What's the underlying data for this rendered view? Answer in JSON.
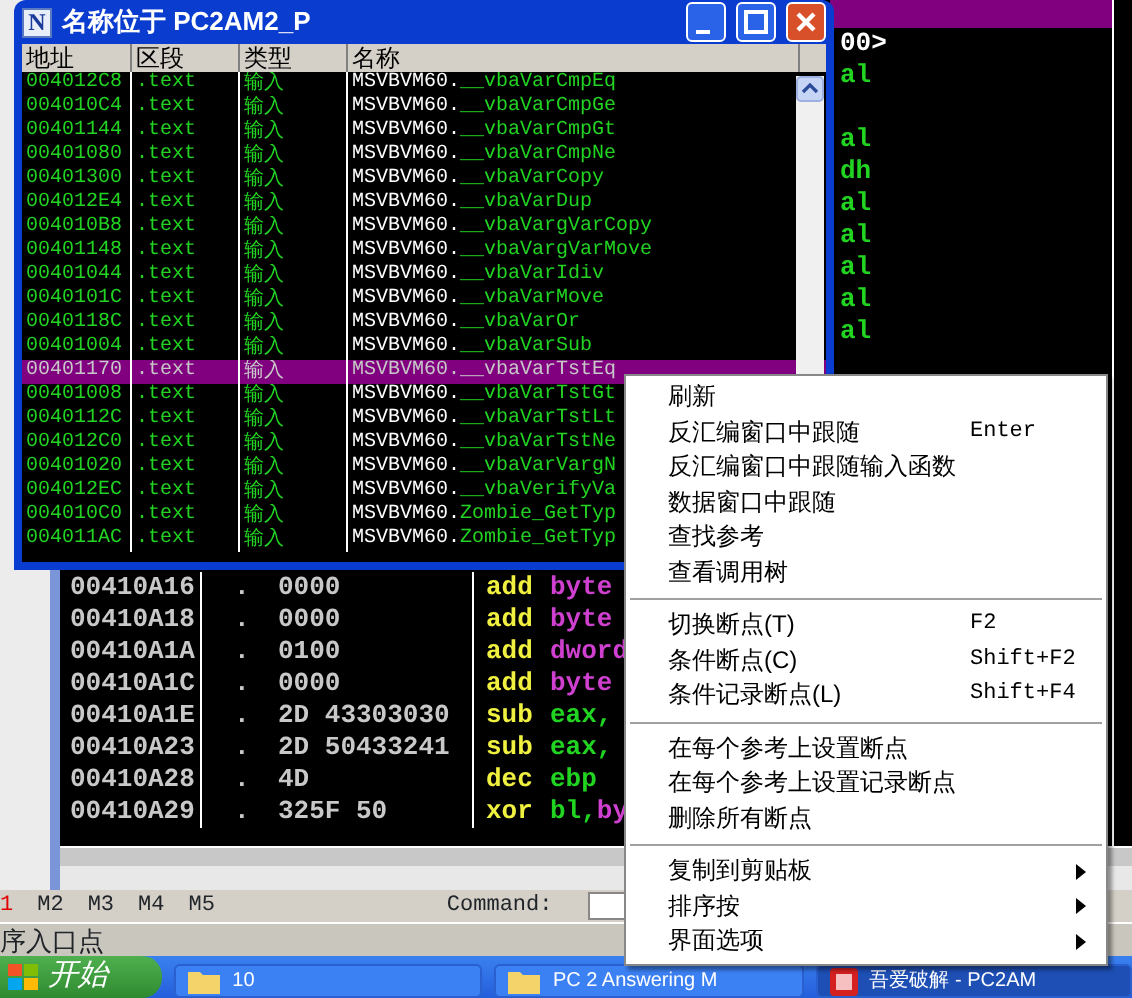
{
  "names_window": {
    "icon_letter": "N",
    "title": "名称位于 PC2AM2_P",
    "columns": [
      "地址",
      "区段",
      "类型",
      "名称"
    ],
    "rows": [
      {
        "address": "004012C8",
        "section": ".text",
        "type": "输入",
        "module": "MSVBVM60.",
        "function": "__vbaVarCmpEq",
        "selected": false
      },
      {
        "address": "004010C4",
        "section": ".text",
        "type": "输入",
        "module": "MSVBVM60.",
        "function": "__vbaVarCmpGe",
        "selected": false
      },
      {
        "address": "00401144",
        "section": ".text",
        "type": "输入",
        "module": "MSVBVM60.",
        "function": "__vbaVarCmpGt",
        "selected": false
      },
      {
        "address": "00401080",
        "section": ".text",
        "type": "输入",
        "module": "MSVBVM60.",
        "function": "__vbaVarCmpNe",
        "selected": false
      },
      {
        "address": "00401300",
        "section": ".text",
        "type": "输入",
        "module": "MSVBVM60.",
        "function": "__vbaVarCopy",
        "selected": false
      },
      {
        "address": "004012E4",
        "section": ".text",
        "type": "输入",
        "module": "MSVBVM60.",
        "function": "__vbaVarDup",
        "selected": false
      },
      {
        "address": "004010B8",
        "section": ".text",
        "type": "输入",
        "module": "MSVBVM60.",
        "function": "__vbaVargVarCopy",
        "selected": false
      },
      {
        "address": "00401148",
        "section": ".text",
        "type": "输入",
        "module": "MSVBVM60.",
        "function": "__vbaVargVarMove",
        "selected": false
      },
      {
        "address": "00401044",
        "section": ".text",
        "type": "输入",
        "module": "MSVBVM60.",
        "function": "__vbaVarIdiv",
        "selected": false
      },
      {
        "address": "0040101C",
        "section": ".text",
        "type": "输入",
        "module": "MSVBVM60.",
        "function": "__vbaVarMove",
        "selected": false
      },
      {
        "address": "0040118C",
        "section": ".text",
        "type": "输入",
        "module": "MSVBVM60.",
        "function": "__vbaVarOr",
        "selected": false
      },
      {
        "address": "00401004",
        "section": ".text",
        "type": "输入",
        "module": "MSVBVM60.",
        "function": "__vbaVarSub",
        "selected": false
      },
      {
        "address": "00401170",
        "section": ".text",
        "type": "输入",
        "module": "MSVBVM60.",
        "function": "__vbaVarTstEq",
        "selected": true
      },
      {
        "address": "00401008",
        "section": ".text",
        "type": "输入",
        "module": "MSVBVM60.",
        "function": "__vbaVarTstGt",
        "selected": false
      },
      {
        "address": "0040112C",
        "section": ".text",
        "type": "输入",
        "module": "MSVBVM60.",
        "function": "__vbaVarTstLt",
        "selected": false
      },
      {
        "address": "004012C0",
        "section": ".text",
        "type": "输入",
        "module": "MSVBVM60.",
        "function": "__vbaVarTstNe",
        "selected": false
      },
      {
        "address": "00401020",
        "section": ".text",
        "type": "输入",
        "module": "MSVBVM60.",
        "function": "__vbaVarVargN",
        "selected": false
      },
      {
        "address": "004012EC",
        "section": ".text",
        "type": "输入",
        "module": "MSVBVM60.",
        "function": "__vbaVerifyVa",
        "selected": false
      },
      {
        "address": "004010C0",
        "section": ".text",
        "type": "输入",
        "module": "MSVBVM60.",
        "function": "Zombie_GetTyp",
        "selected": false
      },
      {
        "address": "004011AC",
        "section": ".text",
        "type": "输入",
        "module": "MSVBVM60.",
        "function": "Zombie_GetTyp",
        "selected": false
      }
    ]
  },
  "cpu": {
    "current_line_highlighted": true,
    "fragments": [
      {
        "kind": "label",
        "text": "00>"
      },
      {
        "kind": "reg",
        "text": "al"
      },
      {
        "kind": "blank"
      },
      {
        "kind": "reg",
        "text": "al"
      },
      {
        "kind": "reg",
        "text": "dh"
      },
      {
        "kind": "reg",
        "text": "al"
      },
      {
        "kind": "reg",
        "text": "al"
      },
      {
        "kind": "reg",
        "text": "al"
      },
      {
        "kind": "reg",
        "text": "al"
      },
      {
        "kind": "reg",
        "text": "al"
      }
    ],
    "rows": [
      {
        "address": "00410A16",
        "dot": ".",
        "hex": "0000",
        "mnemonic": "add",
        "operands": [
          {
            "kind": "size",
            "text": "byte"
          }
        ]
      },
      {
        "address": "00410A18",
        "dot": ".",
        "hex": "0000",
        "mnemonic": "add",
        "operands": [
          {
            "kind": "size",
            "text": "byte"
          }
        ]
      },
      {
        "address": "00410A1A",
        "dot": ".",
        "hex": "0100",
        "mnemonic": "add",
        "operands": [
          {
            "kind": "size",
            "text": "dword"
          }
        ]
      },
      {
        "address": "00410A1C",
        "dot": ".",
        "hex": "0000",
        "mnemonic": "add",
        "operands": [
          {
            "kind": "size",
            "text": "byte"
          }
        ]
      },
      {
        "address": "00410A1E",
        "dot": ".",
        "hex": "2D 43303030",
        "mnemonic": "sub",
        "operands": [
          {
            "kind": "reg",
            "text": "eax,"
          }
        ]
      },
      {
        "address": "00410A23",
        "dot": ".",
        "hex": "2D 50433241",
        "mnemonic": "sub",
        "operands": [
          {
            "kind": "reg",
            "text": "eax,"
          }
        ]
      },
      {
        "address": "00410A28",
        "dot": ".",
        "hex": "4D",
        "mnemonic": "dec",
        "operands": [
          {
            "kind": "reg",
            "text": "ebp"
          }
        ]
      },
      {
        "address": "00410A29",
        "dot": ".",
        "hex": "325F 50",
        "mnemonic": "xor",
        "operands": [
          {
            "kind": "reg",
            "text": "bl,"
          },
          {
            "kind": "size",
            "text": "by"
          }
        ]
      }
    ]
  },
  "context_menu": [
    {
      "kind": "item",
      "label": "刷新",
      "submenu": false
    },
    {
      "kind": "item",
      "label": "反汇编窗口中跟随",
      "shortcut": "Enter",
      "submenu": false
    },
    {
      "kind": "item",
      "label": "反汇编窗口中跟随输入函数",
      "submenu": false
    },
    {
      "kind": "item",
      "label": "数据窗口中跟随",
      "submenu": false
    },
    {
      "kind": "item",
      "label": "查找参考",
      "submenu": false
    },
    {
      "kind": "item",
      "label": "查看调用树",
      "submenu": false
    },
    {
      "kind": "separator"
    },
    {
      "kind": "item",
      "label": "切换断点(T)",
      "shortcut": "F2",
      "submenu": false
    },
    {
      "kind": "item",
      "label": "条件断点(C)",
      "shortcut": "Shift+F2",
      "submenu": false
    },
    {
      "kind": "item",
      "label": "条件记录断点(L)",
      "shortcut": "Shift+F4",
      "submenu": false
    },
    {
      "kind": "separator"
    },
    {
      "kind": "item",
      "label": "在每个参考上设置断点",
      "submenu": false
    },
    {
      "kind": "item",
      "label": "在每个参考上设置记录断点",
      "submenu": false
    },
    {
      "kind": "item",
      "label": "删除所有断点",
      "submenu": false
    },
    {
      "kind": "separator"
    },
    {
      "kind": "item",
      "label": "复制到剪贴板",
      "submenu": true
    },
    {
      "kind": "item",
      "label": "排序按",
      "submenu": true
    },
    {
      "kind": "item",
      "label": "界面选项",
      "submenu": true
    }
  ],
  "command_bar": {
    "marks": [
      {
        "label": "1",
        "active": true
      },
      {
        "label": "M2",
        "active": false
      },
      {
        "label": "M3",
        "active": false
      },
      {
        "label": "M4",
        "active": false
      },
      {
        "label": "M5",
        "active": false
      }
    ],
    "command_label": "Command:"
  },
  "status_bar": "序入口点",
  "taskbar": {
    "start": "开始",
    "buttons": [
      {
        "label": "10",
        "kind": "folder",
        "active": false
      },
      {
        "label": "PC 2 Answering M",
        "kind": "folder",
        "active": false
      },
      {
        "label": "吾爱破解 - PC2AM",
        "kind": "app",
        "active": true
      }
    ]
  }
}
